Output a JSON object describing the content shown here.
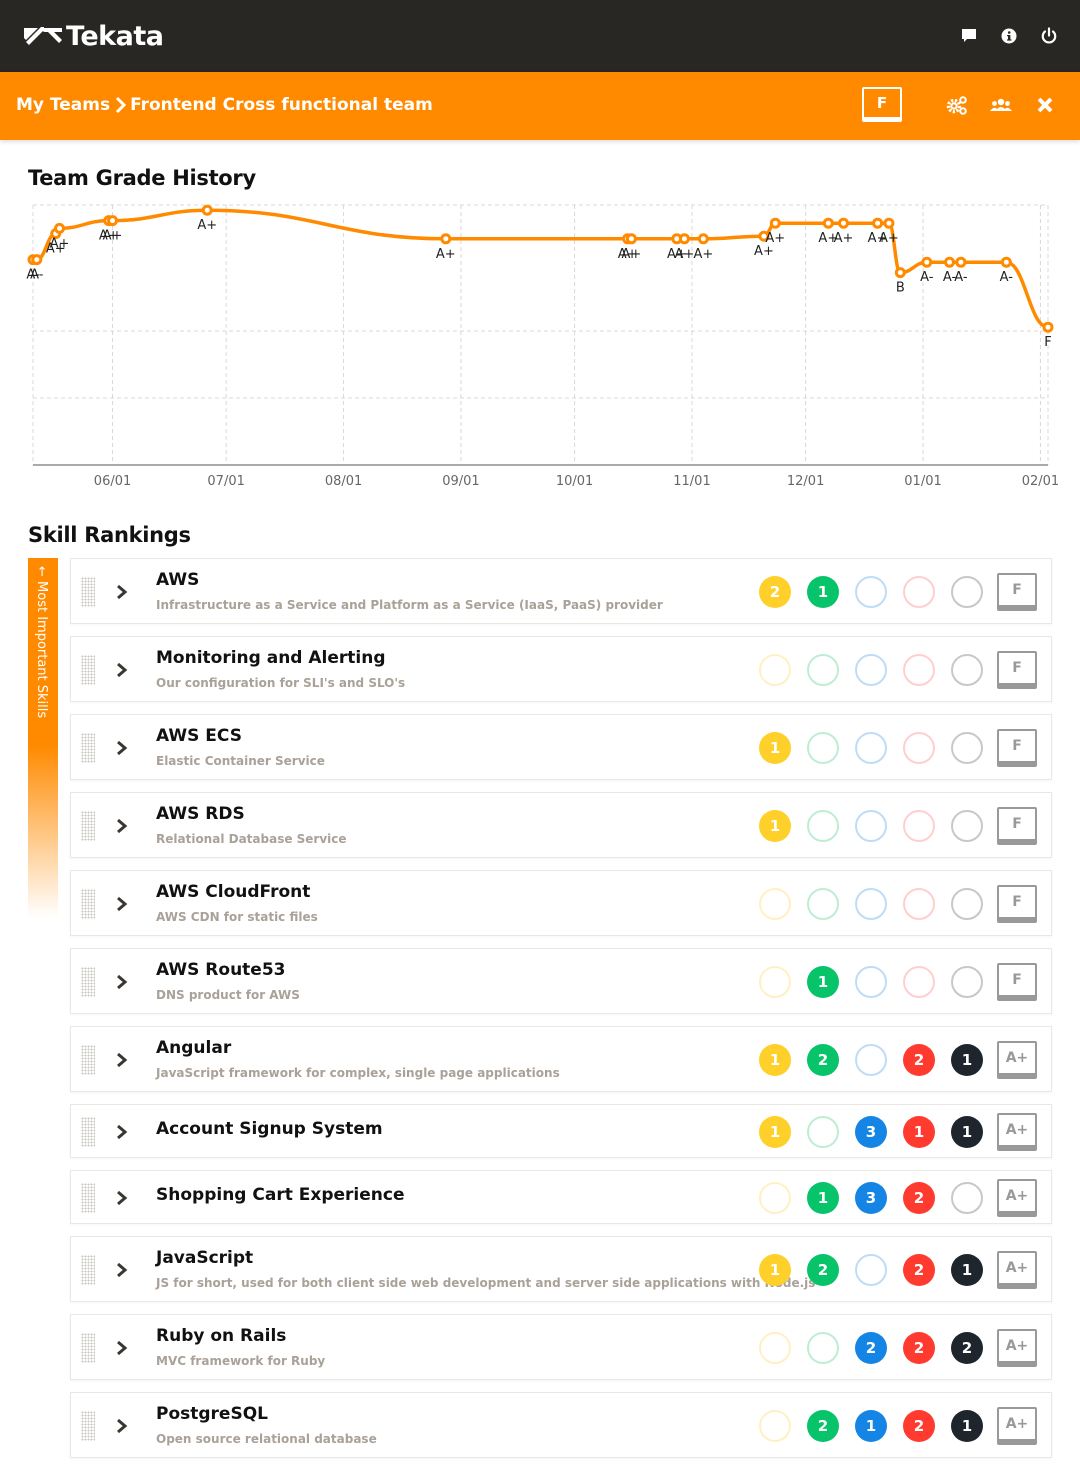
{
  "app": {
    "name": "Tekata",
    "top_icons": [
      {
        "name": "chat-icon",
        "label": "Messages"
      },
      {
        "name": "info-icon",
        "label": "Info"
      },
      {
        "name": "power-icon",
        "label": "Log out"
      }
    ]
  },
  "breadcrumb": {
    "root": "My Teams",
    "current": "Frontend Cross functional team"
  },
  "team_actions": {
    "grade": "F",
    "icons": [
      "settings-gears-icon",
      "team-members-icon",
      "close-icon"
    ]
  },
  "colors": {
    "accent": "#ff8a00",
    "topbar": "#282724",
    "level_colors": [
      "#ffd02a",
      "#07c46a",
      "#1485e4",
      "#ff3b30",
      "#1f252d"
    ],
    "level_empty_colors": [
      "#fff0c4",
      "#bdeed3",
      "#bfdcf6",
      "#ffcfcf",
      "#c8c8c8"
    ]
  },
  "grade_history": {
    "title": "Team Grade History"
  },
  "chart_data": {
    "type": "line",
    "title": "Team Grade History",
    "xlabel": "",
    "ylabel": "",
    "x_tick_labels": [
      "06/01",
      "07/01",
      "08/01",
      "09/01",
      "10/01",
      "11/01",
      "12/01",
      "01/01",
      "02/01"
    ],
    "x_range": [
      "05/11",
      "02/03"
    ],
    "y_scale_note": "grade score, higher is better; y gridlines at 3 levels, no y tick labels",
    "y_range": [
      0,
      100
    ],
    "grid": true,
    "series": [
      {
        "name": "Team grade",
        "color": "#ff8a00",
        "points": [
          {
            "date": "05/11",
            "value": 79,
            "label": "A-"
          },
          {
            "date": "05/12",
            "value": 79,
            "label": "A-"
          },
          {
            "date": "05/17",
            "value": 89,
            "label": "A+"
          },
          {
            "date": "05/18",
            "value": 91,
            "label": "A+"
          },
          {
            "date": "05/31",
            "value": 94,
            "label": "A+"
          },
          {
            "date": "06/01",
            "value": 94,
            "label": "A+"
          },
          {
            "date": "06/26",
            "value": 98,
            "label": "A+"
          },
          {
            "date": "08/28",
            "value": 87,
            "label": "A+"
          },
          {
            "date": "10/15",
            "value": 87,
            "label": "A+"
          },
          {
            "date": "10/16",
            "value": 87,
            "label": "A+"
          },
          {
            "date": "10/28",
            "value": 87,
            "label": "A+"
          },
          {
            "date": "10/30",
            "value": 87,
            "label": "A+"
          },
          {
            "date": "11/04",
            "value": 87,
            "label": "A+"
          },
          {
            "date": "11/20",
            "value": 88,
            "label": "A+"
          },
          {
            "date": "11/23",
            "value": 93,
            "label": "A+"
          },
          {
            "date": "12/07",
            "value": 93,
            "label": "A+"
          },
          {
            "date": "12/11",
            "value": 93,
            "label": "A+"
          },
          {
            "date": "12/20",
            "value": 93,
            "label": "A+"
          },
          {
            "date": "12/23",
            "value": 93,
            "label": "A+"
          },
          {
            "date": "12/26",
            "value": 74,
            "label": "B"
          },
          {
            "date": "01/02",
            "value": 78,
            "label": "A-"
          },
          {
            "date": "01/08",
            "value": 78,
            "label": "A-"
          },
          {
            "date": "01/11",
            "value": 78,
            "label": "A-"
          },
          {
            "date": "01/23",
            "value": 78,
            "label": "A-"
          },
          {
            "date": "02/03",
            "value": 53,
            "label": "F"
          }
        ]
      }
    ]
  },
  "skill_rankings": {
    "title": "Skill Rankings",
    "sidebar_label": "← Most Important Skills",
    "skills": [
      {
        "name": "AWS",
        "description": "Infrastructure as a Service and Platform as a Service (IaaS, PaaS) provider",
        "levels": [
          2,
          1,
          0,
          0,
          0
        ],
        "grade": "F"
      },
      {
        "name": "Monitoring and Alerting",
        "description": "Our configuration for SLI's and SLO's",
        "levels": [
          0,
          0,
          0,
          0,
          0
        ],
        "grade": "F"
      },
      {
        "name": "AWS ECS",
        "description": "Elastic Container Service",
        "levels": [
          1,
          0,
          0,
          0,
          0
        ],
        "grade": "F"
      },
      {
        "name": "AWS RDS",
        "description": "Relational Database Service",
        "levels": [
          1,
          0,
          0,
          0,
          0
        ],
        "grade": "F"
      },
      {
        "name": "AWS CloudFront",
        "description": "AWS CDN for static files",
        "levels": [
          0,
          0,
          0,
          0,
          0
        ],
        "grade": "F"
      },
      {
        "name": "AWS Route53",
        "description": "DNS product for AWS",
        "levels": [
          0,
          1,
          0,
          0,
          0
        ],
        "grade": "F"
      },
      {
        "name": "Angular",
        "description": "JavaScript framework for complex, single page applications",
        "levels": [
          1,
          2,
          0,
          2,
          1
        ],
        "grade": "A+"
      },
      {
        "name": "Account Signup System",
        "description": "",
        "levels": [
          1,
          0,
          3,
          1,
          1
        ],
        "grade": "A+"
      },
      {
        "name": "Shopping Cart Experience",
        "description": "",
        "levels": [
          0,
          1,
          3,
          2,
          0
        ],
        "grade": "A+"
      },
      {
        "name": "JavaScript",
        "description": "JS for short, used for both client side web development and server side applications with Node.js",
        "levels": [
          1,
          2,
          0,
          2,
          1
        ],
        "grade": "A+"
      },
      {
        "name": "Ruby on Rails",
        "description": "MVC framework for Ruby",
        "levels": [
          0,
          0,
          2,
          2,
          2
        ],
        "grade": "A+"
      },
      {
        "name": "PostgreSQL",
        "description": "Open source relational database",
        "levels": [
          0,
          2,
          1,
          2,
          1
        ],
        "grade": "A+"
      }
    ]
  }
}
